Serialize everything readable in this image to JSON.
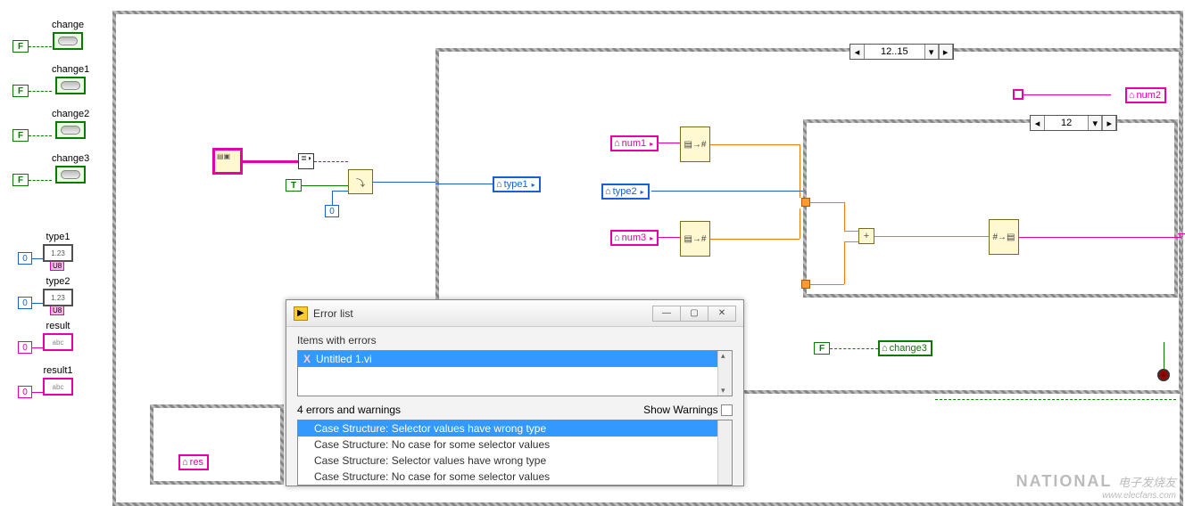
{
  "palette": {
    "change": {
      "label": "change"
    },
    "change1": {
      "label": "change1"
    },
    "change2": {
      "label": "change2"
    },
    "change3": {
      "label": "change3"
    },
    "type1": {
      "label": "type1"
    },
    "type2": {
      "label": "type2"
    },
    "result": {
      "label": "result"
    },
    "result1": {
      "label": "result1"
    }
  },
  "const": {
    "F": "F",
    "T": "T",
    "zero": "0"
  },
  "locals": {
    "type1": "type1",
    "type2": "type2",
    "num1": "num1",
    "num2": "num2",
    "num3": "num3",
    "change3": "change3",
    "res": "res"
  },
  "case_outer": "12..15",
  "case_inner": "12",
  "errwin": {
    "title": "Error list",
    "section1": "Items with errors",
    "item1": "Untitled 1.vi",
    "section2": "4 errors and warnings",
    "show_warnings": "Show Warnings",
    "details": [
      "Case Structure: Selector values have wrong type",
      "Case Structure: No case for some selector values",
      "Case Structure: Selector values have wrong type",
      "Case Structure: No case for some selector values"
    ]
  },
  "watermark": {
    "ni": "NATIONAL",
    "cn": "电子发烧友",
    "url": "www.elecfans.com"
  }
}
